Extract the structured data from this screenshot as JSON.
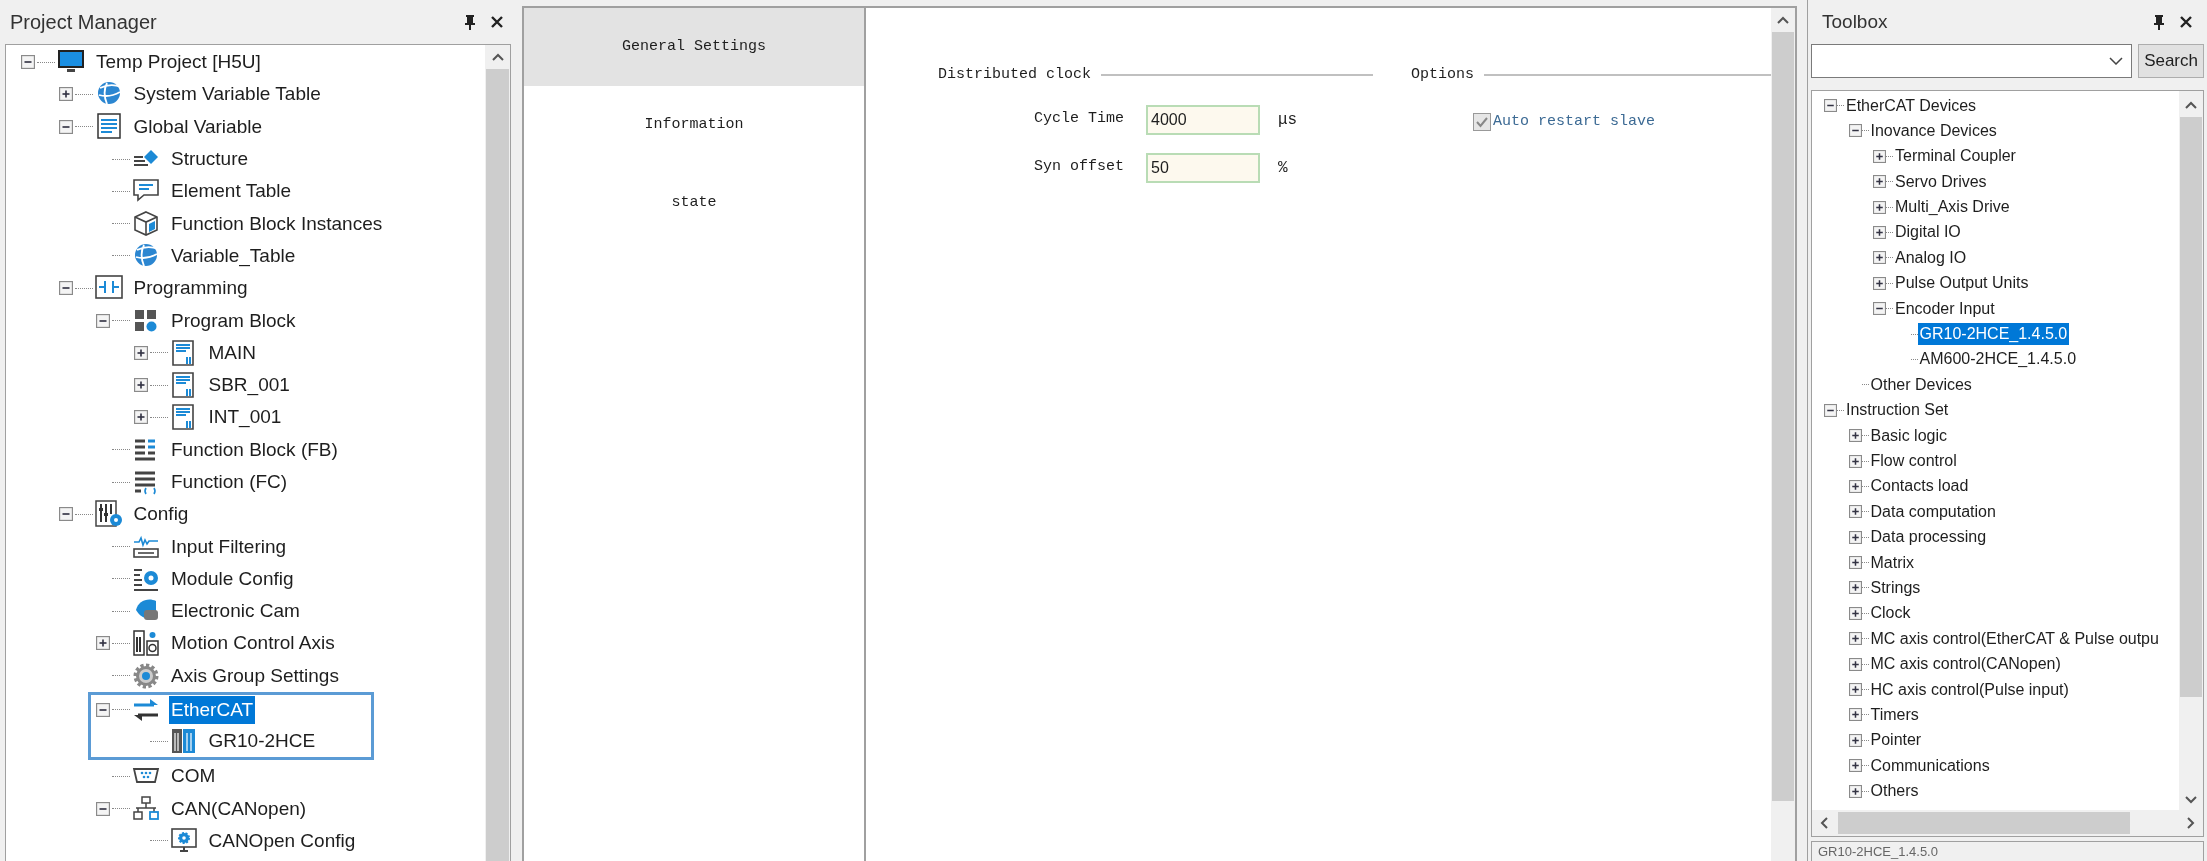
{
  "project_manager": {
    "title": "Project Manager",
    "tree": [
      {
        "label": "Temp Project [H5U]",
        "kind": "project",
        "selected": false,
        "expanded": true,
        "children": [
          {
            "label": "System Variable Table",
            "kind": "globe",
            "selected": false,
            "expanded": false
          },
          {
            "label": "Global Variable",
            "kind": "document",
            "selected": false,
            "expanded": true,
            "children": [
              {
                "label": "Structure",
                "kind": "structure",
                "selected": false
              },
              {
                "label": "Element Table",
                "kind": "bubble",
                "selected": false
              },
              {
                "label": "Function Block Instances",
                "kind": "cube",
                "selected": false
              },
              {
                "label": "Variable_Table",
                "kind": "globe",
                "selected": false
              }
            ]
          },
          {
            "label": "Programming",
            "kind": "contact",
            "selected": false,
            "expanded": true,
            "children": [
              {
                "label": "Program Block",
                "kind": "blocks",
                "selected": false,
                "expanded": true,
                "children": [
                  {
                    "label": "MAIN",
                    "kind": "program",
                    "selected": false,
                    "expanded": false
                  },
                  {
                    "label": "SBR_001",
                    "kind": "program",
                    "selected": false,
                    "expanded": false
                  },
                  {
                    "label": "INT_001",
                    "kind": "program",
                    "selected": false,
                    "expanded": false
                  }
                ]
              },
              {
                "label": "Function Block (FB)",
                "kind": "fb",
                "selected": false
              },
              {
                "label": "Function (FC)",
                "kind": "fc",
                "selected": false
              }
            ]
          },
          {
            "label": "Config",
            "kind": "config",
            "selected": false,
            "expanded": true,
            "children": [
              {
                "label": "Input Filtering",
                "kind": "filter",
                "selected": false
              },
              {
                "label": "Module Config",
                "kind": "module",
                "selected": false
              },
              {
                "label": "Electronic Cam",
                "kind": "cam",
                "selected": false
              },
              {
                "label": "Motion Control Axis",
                "kind": "axis",
                "selected": false,
                "expanded": false
              },
              {
                "label": "Axis Group Settings",
                "kind": "gear",
                "selected": false
              },
              {
                "label": "EtherCAT",
                "kind": "ethercat",
                "selected": true,
                "expanded": true,
                "outlined": true,
                "children": [
                  {
                    "label": "GR10-2HCE",
                    "kind": "device",
                    "selected": false
                  }
                ]
              },
              {
                "label": "COM",
                "kind": "com",
                "selected": false
              },
              {
                "label": "CAN(CANopen)",
                "kind": "network",
                "selected": false,
                "expanded": true,
                "children": [
                  {
                    "label": "CANOpen Config",
                    "kind": "screen-gear",
                    "selected": false
                  }
                ]
              }
            ]
          }
        ]
      }
    ]
  },
  "editor": {
    "tabs": [
      {
        "label": "General Settings",
        "selected": true
      },
      {
        "label": "Information",
        "selected": false
      },
      {
        "label": "state",
        "selected": false
      }
    ],
    "distributed_clock": {
      "heading": "Distributed clock",
      "fields": [
        {
          "label": "Cycle Time",
          "value": "4000",
          "unit": "μs"
        },
        {
          "label": "Syn offset",
          "value": "50",
          "unit": "%"
        }
      ]
    },
    "options": {
      "heading": "Options",
      "checkbox": {
        "label": "Auto restart slave",
        "checked": true,
        "disabled": true
      }
    }
  },
  "toolbox": {
    "title": "Toolbox",
    "search_button": "Search",
    "tree": [
      {
        "label": "EtherCAT Devices",
        "selected": false,
        "expanded": true,
        "children": [
          {
            "label": "Inovance Devices",
            "selected": false,
            "expanded": true,
            "children": [
              {
                "label": "Terminal Coupler",
                "selected": false,
                "expanded": false
              },
              {
                "label": "Servo Drives",
                "selected": false,
                "expanded": false
              },
              {
                "label": "Multi_Axis Drive",
                "selected": false,
                "expanded": false
              },
              {
                "label": "Digital IO",
                "selected": false,
                "expanded": false
              },
              {
                "label": "Analog IO",
                "selected": false,
                "expanded": false
              },
              {
                "label": "Pulse Output Units",
                "selected": false,
                "expanded": false
              },
              {
                "label": "Encoder Input",
                "selected": false,
                "expanded": true,
                "children": [
                  {
                    "label": "GR10-2HCE_1.4.5.0",
                    "selected": true
                  },
                  {
                    "label": "AM600-2HCE_1.4.5.0",
                    "selected": false
                  }
                ]
              }
            ]
          },
          {
            "label": "Other Devices",
            "selected": false
          }
        ]
      },
      {
        "label": "Instruction Set",
        "selected": false,
        "expanded": true,
        "children": [
          {
            "label": "Basic logic",
            "selected": false,
            "expanded": false
          },
          {
            "label": "Flow control",
            "selected": false,
            "expanded": false
          },
          {
            "label": "Contacts load",
            "selected": false,
            "expanded": false
          },
          {
            "label": "Data computation",
            "selected": false,
            "expanded": false
          },
          {
            "label": "Data processing",
            "selected": false,
            "expanded": false
          },
          {
            "label": "Matrix",
            "selected": false,
            "expanded": false
          },
          {
            "label": "Strings",
            "selected": false,
            "expanded": false
          },
          {
            "label": "Clock",
            "selected": false,
            "expanded": false
          },
          {
            "label": "MC axis control(EtherCAT & Pulse outpu",
            "selected": false,
            "expanded": false
          },
          {
            "label": "MC axis control(CANopen)",
            "selected": false,
            "expanded": false
          },
          {
            "label": "HC axis control(Pulse input)",
            "selected": false,
            "expanded": false
          },
          {
            "label": "Timers",
            "selected": false,
            "expanded": false
          },
          {
            "label": "Pointer",
            "selected": false,
            "expanded": false
          },
          {
            "label": "Communications",
            "selected": false,
            "expanded": false
          },
          {
            "label": "Others",
            "selected": false,
            "expanded": false
          }
        ]
      }
    ],
    "description": "GR10-2HCE_1.4.5.0"
  }
}
